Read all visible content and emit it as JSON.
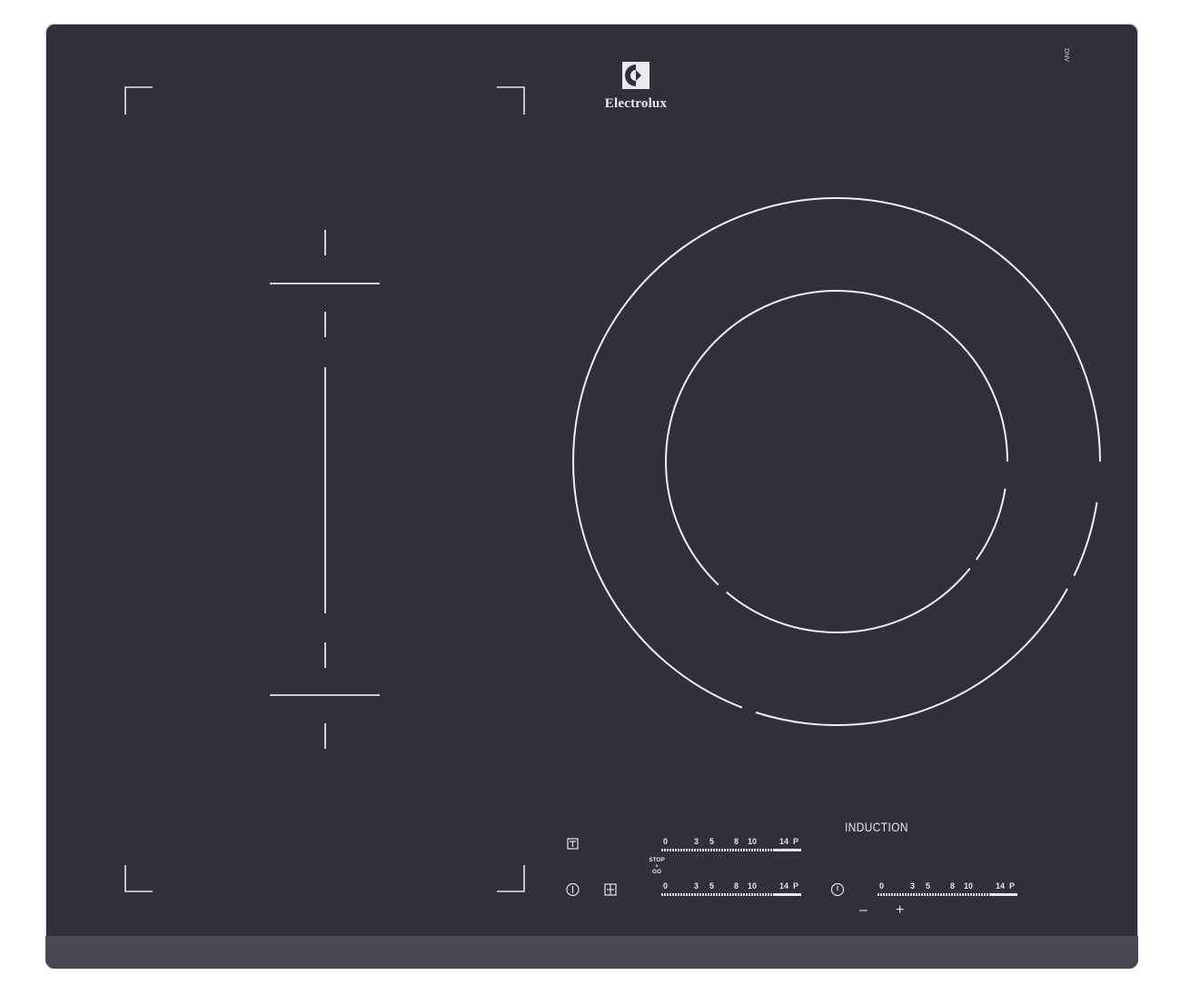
{
  "brand": {
    "name": "Electrolux",
    "logo_icon": "electrolux-logo-icon"
  },
  "corner_mark": "DNV",
  "label": {
    "induction": "INDUCTION"
  },
  "controls": {
    "stop_go": {
      "line1": "STOP",
      "line2": "+",
      "line3": "GO"
    },
    "slider_scale": [
      "0",
      "3",
      "5",
      "8",
      "10",
      "14",
      "P"
    ],
    "timer": {
      "minus": "–",
      "plus": "+"
    }
  },
  "colors": {
    "glass": "#2d313a",
    "print": "#e4e6e9",
    "frame": "#44484f"
  }
}
